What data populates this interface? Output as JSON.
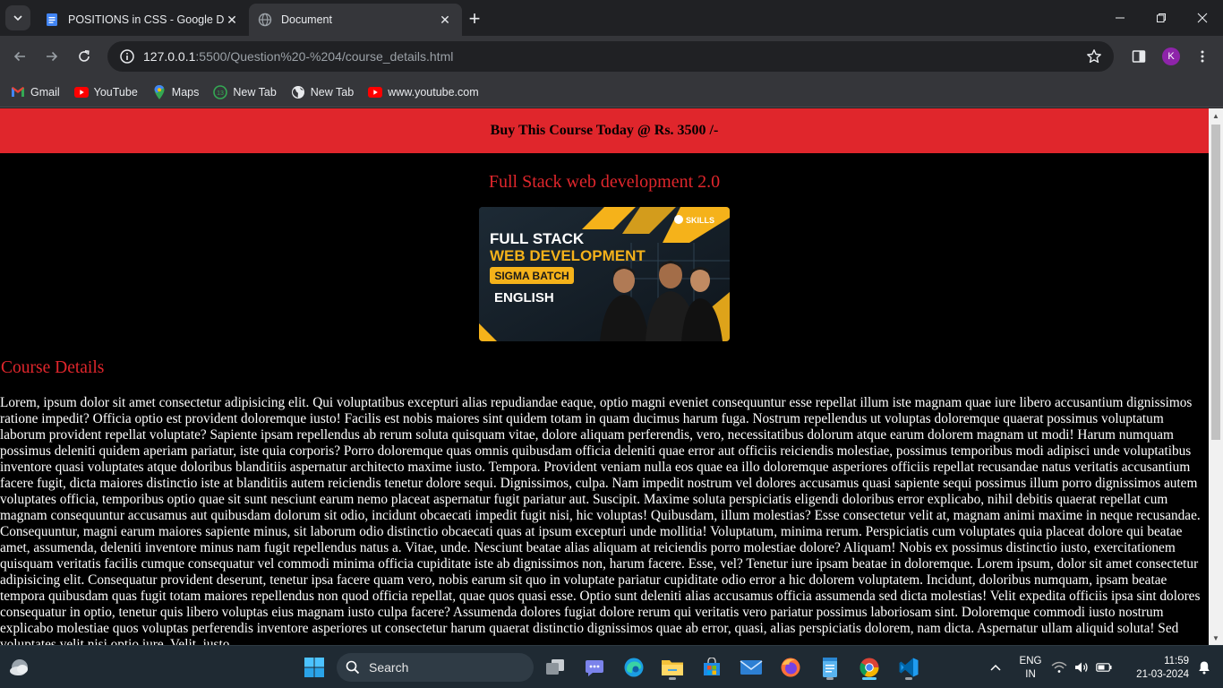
{
  "browser": {
    "tabs": [
      {
        "title": "POSITIONS in CSS - Google Doc",
        "active": false
      },
      {
        "title": "Document",
        "active": true
      }
    ],
    "url_host": "127.0.0.1",
    "url_rest": ":5500/Question%20-%204/course_details.html",
    "profile_initial": "K",
    "bookmarks": [
      {
        "label": "Gmail",
        "icon": "gmail-icon"
      },
      {
        "label": "YouTube",
        "icon": "youtube-icon"
      },
      {
        "label": "Maps",
        "icon": "maps-icon"
      },
      {
        "label": "New Tab",
        "icon": "new-tab-badge-icon"
      },
      {
        "label": "New Tab",
        "icon": "globe-icon"
      },
      {
        "label": "www.youtube.com",
        "icon": "youtube-icon"
      }
    ]
  },
  "page": {
    "banner": "Buy This Course Today @ Rs. 3500 /-",
    "course_title": "Full Stack web development 2.0",
    "image": {
      "line1": "FULL STACK",
      "line2": "WEB DEVELOPMENT",
      "badge": "SIGMA BATCH",
      "language": "ENGLISH",
      "brand": "SKILLS"
    },
    "details_heading": "Course Details",
    "details_text": "Lorem, ipsum dolor sit amet consectetur adipisicing elit. Qui voluptatibus excepturi alias repudiandae eaque, optio magni eveniet consequuntur esse repellat illum iste magnam quae iure libero accusantium dignissimos ratione impedit? Officia optio est provident doloremque iusto! Facilis est nobis maiores sint quidem totam in quam ducimus harum fuga. Nostrum repellendus ut voluptas doloremque quaerat possimus voluptatum laborum provident repellat voluptate? Sapiente ipsam repellendus ab rerum soluta quisquam vitae, dolore aliquam perferendis, vero, necessitatibus dolorum atque earum dolorem magnam ut modi! Harum numquam possimus deleniti quidem aperiam pariatur, iste quia corporis? Porro doloremque quas omnis quibusdam officia deleniti quae error aut officiis reiciendis molestiae, possimus temporibus modi adipisci unde voluptatibus inventore quasi voluptates atque doloribus blanditiis aspernatur architecto maxime iusto. Tempora. Provident veniam nulla eos quae ea illo doloremque asperiores officiis repellat recusandae natus veritatis accusantium facere fugit, dicta maiores distinctio iste at blanditiis autem reiciendis tenetur dolore sequi. Dignissimos, culpa. Nam impedit nostrum vel dolores accusamus quasi sapiente sequi possimus illum porro dignissimos autem voluptates officia, temporibus optio quae sit sunt nesciunt earum nemo placeat aspernatur fugit pariatur aut. Suscipit. Maxime soluta perspiciatis eligendi doloribus error explicabo, nihil debitis quaerat repellat cum magnam consequuntur accusamus aut quibusdam dolorum sit odio, incidunt obcaecati impedit fugit nisi, hic voluptas! Quibusdam, illum molestias? Esse consectetur velit at, magnam animi maxime in neque recusandae. Consequuntur, magni earum maiores sapiente minus, sit laborum odio distinctio obcaecati quas at ipsum excepturi unde mollitia! Voluptatum, minima rerum. Perspiciatis cum voluptates quia placeat dolore qui beatae amet, assumenda, deleniti inventore minus nam fugit repellendus natus a. Vitae, unde. Nesciunt beatae alias aliquam at reiciendis porro molestiae dolore? Aliquam! Nobis ex possimus distinctio iusto, exercitationem quisquam veritatis facilis cumque consequatur vel commodi minima officia cupiditate iste ab dignissimos non, harum facere. Esse, vel? Tenetur iure ipsam beatae in doloremque. Lorem ipsum, dolor sit amet consectetur adipisicing elit. Consequatur provident deserunt, tenetur ipsa facere quam vero, nobis earum sit quo in voluptate pariatur cupiditate odio error a hic dolorem voluptatem. Incidunt, doloribus numquam, ipsam beatae tempora quibusdam quas fugit totam maiores repellendus non quod officia repellat, quae quos quasi esse. Optio sunt deleniti alias accusamus officia assumenda sed dicta molestias! Velit expedita officiis ipsa sint dolores consequatur in optio, tenetur quis libero voluptas eius magnam iusto culpa facere? Assumenda dolores fugiat dolore rerum qui veritatis vero pariatur possimus laboriosam sint. Doloremque commodi iusto nostrum explicabo molestiae quos voluptas perferendis inventore asperiores ut consectetur harum quaerat distinctio dignissimos quae ab error, quasi, alias perspiciatis dolorem, nam dicta. Aspernatur ullam aliquid soluta! Sed voluptates velit nisi optio iure. Velit, iusto."
  },
  "taskbar": {
    "search_label": "Search",
    "lang_line1": "ENG",
    "lang_line2": "IN",
    "time": "11:59",
    "date": "21-03-2024"
  },
  "colors": {
    "banner_red": "#e0262c",
    "page_bg": "#000000",
    "chrome_dark": "#202124",
    "chrome_toolbar": "#35363a"
  }
}
